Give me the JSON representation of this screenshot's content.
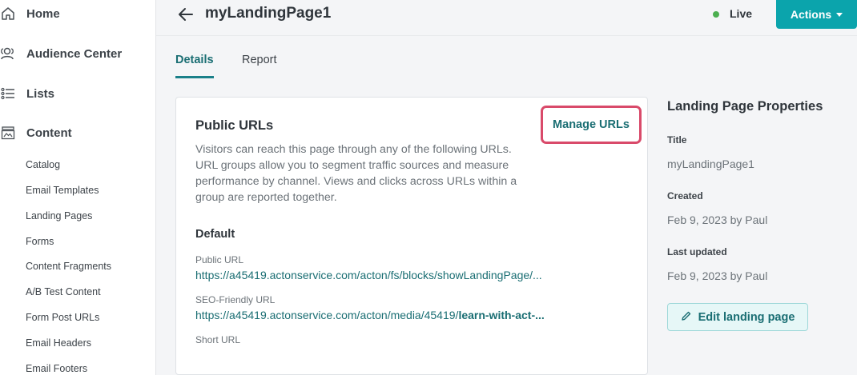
{
  "header": {
    "title": "myLandingPage1",
    "status": "Live",
    "actions_label": "Actions",
    "colors": {
      "accent": "#0ba4ac",
      "live": "#4caf50",
      "highlight": "#d94a6a"
    }
  },
  "sidebar": {
    "main_items": [
      {
        "label": "Home",
        "icon": "home-icon"
      },
      {
        "label": "Audience Center",
        "icon": "users-icon"
      },
      {
        "label": "Lists",
        "icon": "list-icon"
      },
      {
        "label": "Content",
        "icon": "content-icon"
      }
    ],
    "sub_items": [
      "Catalog",
      "Email Templates",
      "Landing Pages",
      "Forms",
      "Content Fragments",
      "A/B Test Content",
      "Form Post URLs",
      "Email Headers",
      "Email Footers"
    ]
  },
  "tabs": [
    {
      "label": "Details",
      "active": true
    },
    {
      "label": "Report",
      "active": false
    }
  ],
  "public_urls": {
    "title": "Public URLs",
    "manage_label": "Manage URLs",
    "description": "Visitors can reach this page through any of the following URLs. URL groups allow you to segment traffic sources and measure performance by channel. Views and clicks across URLs within a group are reported together.",
    "group_title": "Default",
    "public_url_label": "Public URL",
    "public_url_value": "https://a45419.actonservice.com/acton/fs/blocks/showLandingPage/...",
    "seo_url_label": "SEO-Friendly URL",
    "seo_url_prefix": "https://a45419.actonservice.com/acton/media/45419/",
    "seo_url_slug": "learn-with-act-...",
    "short_url_label": "Short URL"
  },
  "properties": {
    "title": "Landing Page Properties",
    "title_label": "Title",
    "title_value": "myLandingPage1",
    "created_label": "Created",
    "created_value": "Feb 9, 2023 by Paul",
    "updated_label": "Last updated",
    "updated_value": "Feb 9, 2023 by Paul",
    "edit_label": "Edit landing page"
  }
}
